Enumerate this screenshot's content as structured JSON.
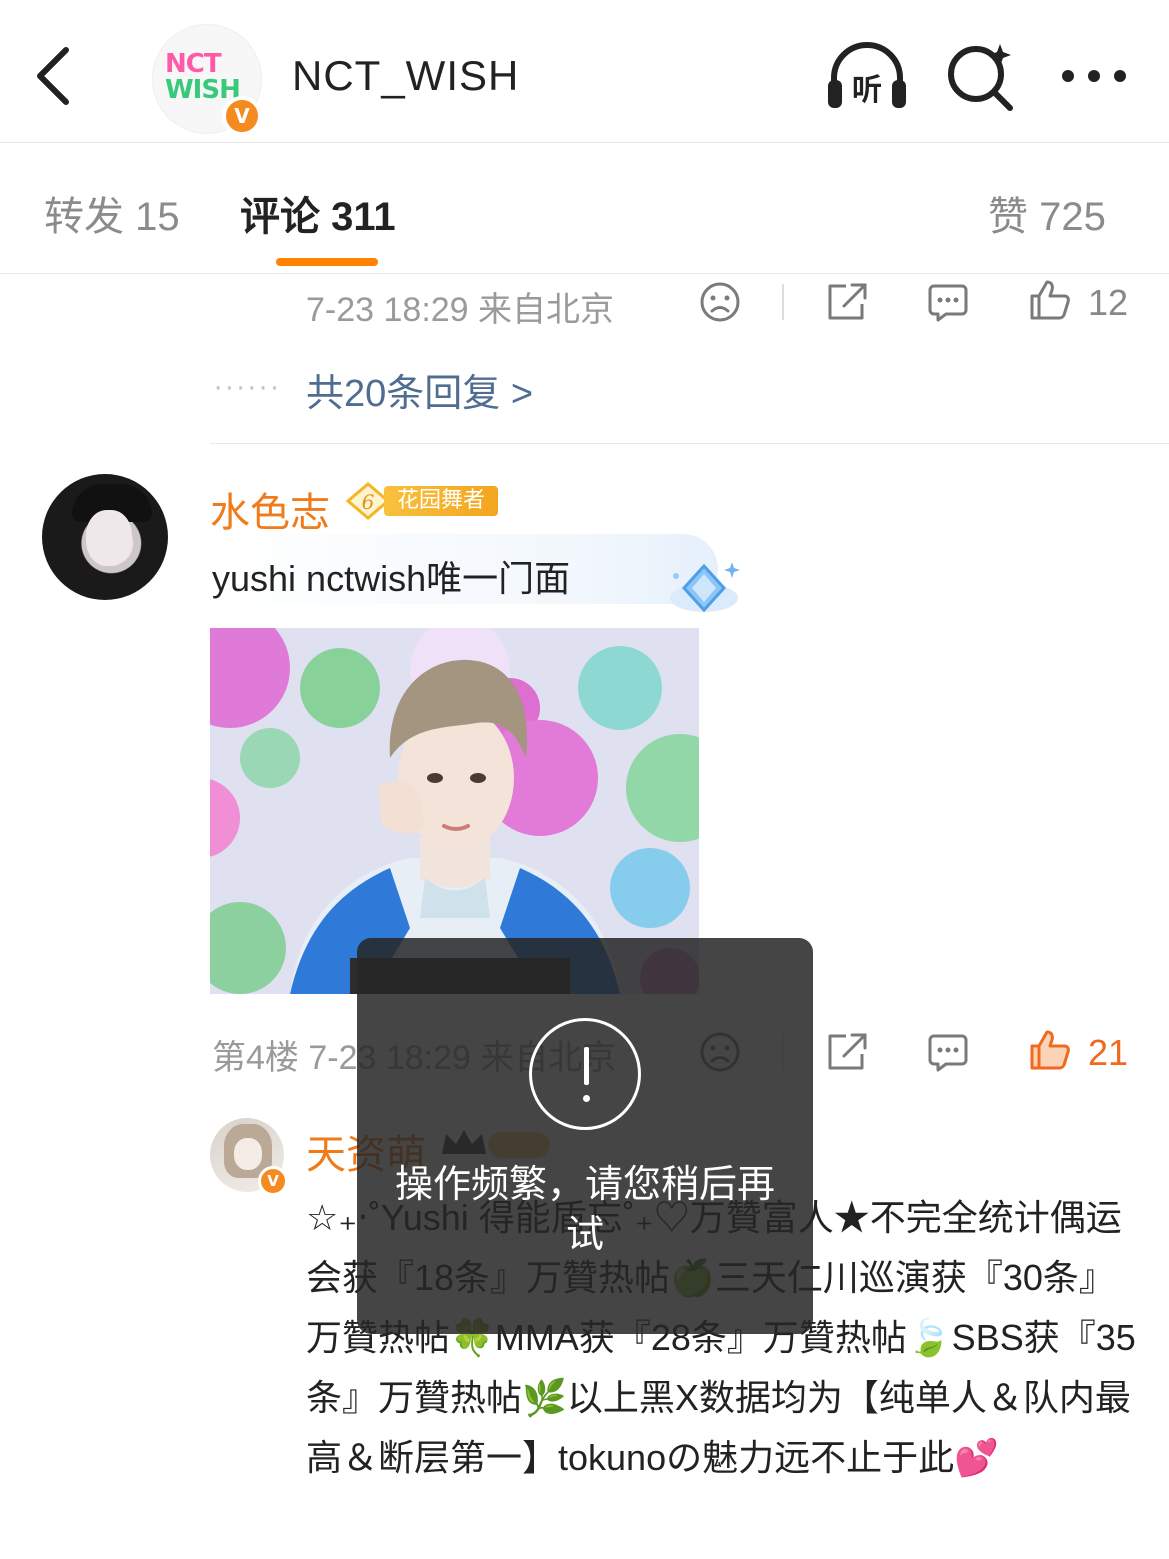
{
  "header": {
    "account_name": "NCT_WISH",
    "logo_line1": "NCT",
    "logo_line2": "WISH",
    "verified_mark": "V",
    "listen_label": "听"
  },
  "tabs": {
    "repost": "转发 15",
    "comments": "评论 311",
    "likes": "赞 725",
    "active": "comments",
    "accent_color": "#ff8200"
  },
  "prev_comment": {
    "meta": "7-23 18:29 来自北京",
    "like_count": "12",
    "reply_dots": "······",
    "replies_link": "共20条回复 >"
  },
  "comment1": {
    "username": "水色志",
    "level": "6",
    "badge_label": "花园舞者",
    "text": "yushi nctwish唯一门面",
    "floor_meta": "第4楼 7-23 18:29 来自北京",
    "like_count": "21",
    "liked": true,
    "name_color": "#f07b1a"
  },
  "comment2": {
    "username": "天资萌",
    "verified_mark": "V",
    "text": "☆₊‧˚Yushi 得能盾忘˚₊♡万贊富人★不完全统计偶运会获『18条』万贊热帖🍏三天仁川巡演获『30条』万贊热帖🍀MMA获『28条』万贊热帖🍃SBS获『35条』万贊热帖🌿以上黑X数据均为【纯单人＆队内最高＆断层第一】tokunoの魅力远不止于此💕"
  },
  "toast": {
    "message": "操作频繁，请您稍后再试",
    "icon": "exclamation-icon"
  },
  "icons": {
    "back": "chevron-left-icon",
    "listen": "headphones-icon",
    "search": "search-icon",
    "more": "more-icon",
    "dislike": "sad-face-icon",
    "share": "share-icon",
    "reply": "comment-icon",
    "like": "thumbs-up-icon"
  }
}
